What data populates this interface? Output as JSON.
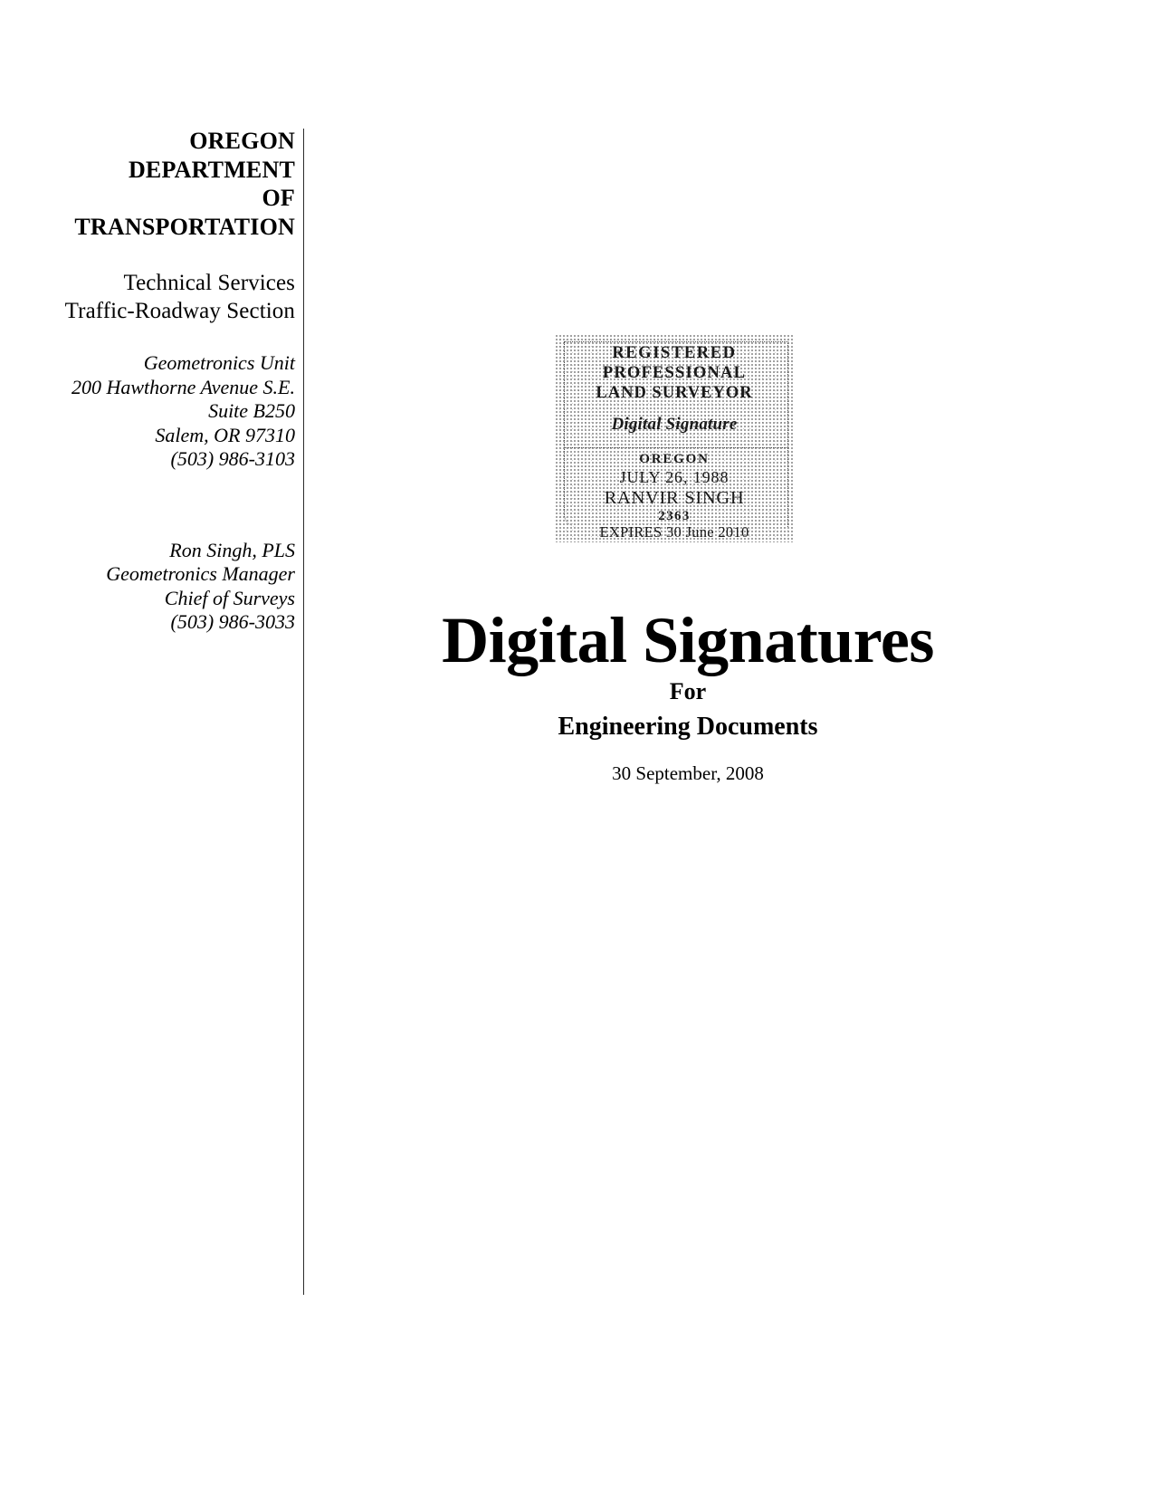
{
  "document": {
    "left_column": {
      "agency_lines": [
        "OREGON",
        "DEPARTMENT",
        "OF",
        "TRANSPORTATION"
      ],
      "division_lines": [
        "Technical Services",
        "Traffic-Roadway Section"
      ],
      "address_lines": [
        "Geometronics Unit",
        "200 Hawthorne Avenue S.E.",
        "Suite B250",
        "Salem, OR 97310",
        "(503) 986-3103"
      ],
      "contact_lines": [
        "Ron Singh, PLS",
        "Geometronics Manager",
        "Chief of Surveys",
        "(503) 986-3033"
      ]
    },
    "seal": {
      "line1": "REGISTERED",
      "line2": "PROFESSIONAL",
      "line3": "LAND SURVEYOR",
      "signature": "Digital Signature",
      "state": "OREGON",
      "date": "JULY 26, 1988",
      "name": "RANVIR SINGH",
      "license_number": "2363",
      "expires": "EXPIRES 30 June 2010"
    },
    "title": {
      "main": "Digital Signatures",
      "for": "For",
      "subject": "Engineering Documents",
      "date": "30 September, 2008"
    }
  }
}
